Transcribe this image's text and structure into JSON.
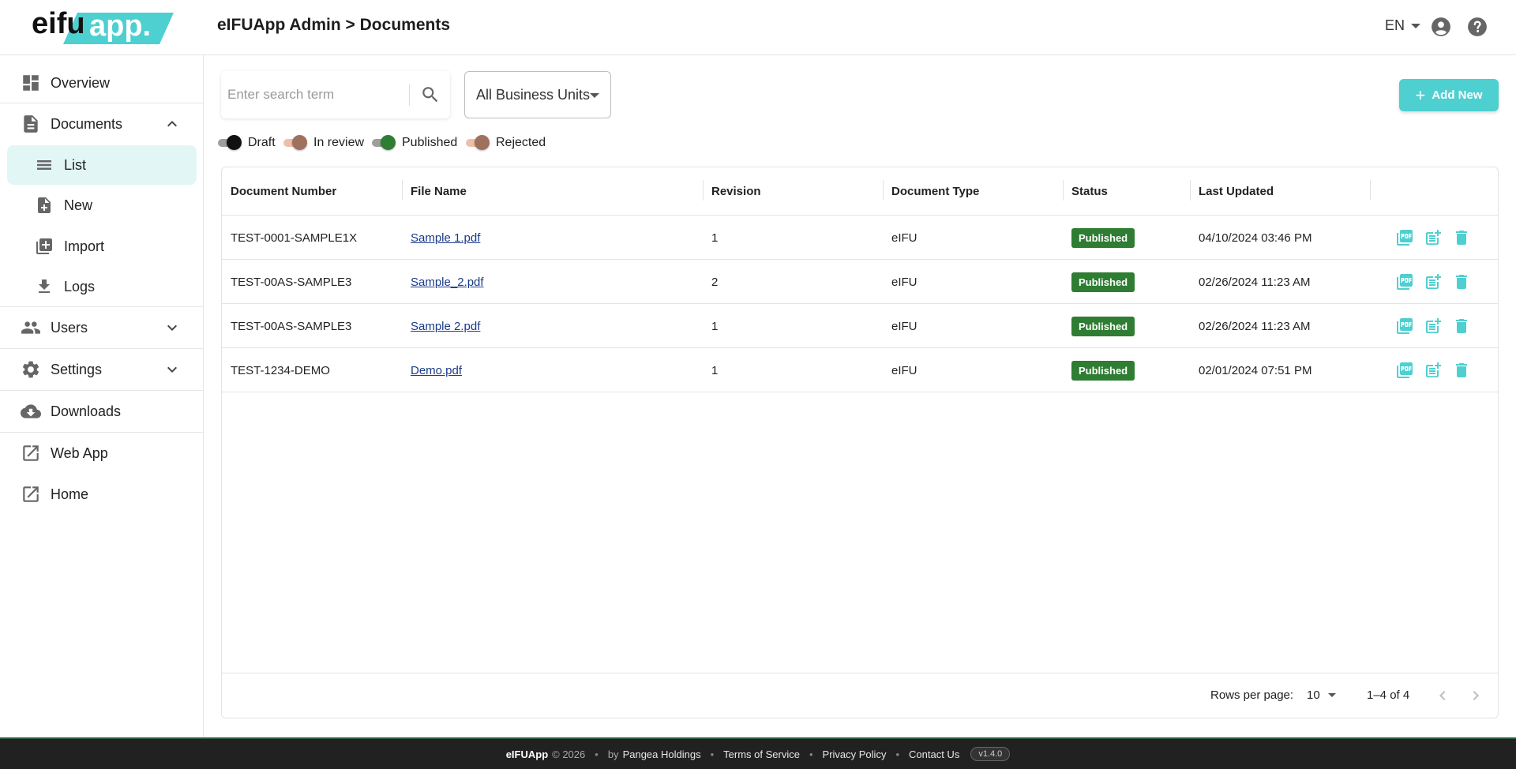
{
  "brand": {
    "logo_text_left": "eifu",
    "logo_text_right": "app.",
    "accent_color": "#4ecfd0"
  },
  "header": {
    "breadcrumb": "eIFUApp Admin > Documents",
    "language": "EN"
  },
  "sidebar": {
    "overview": "Overview",
    "documents": "Documents",
    "documents_sub": {
      "list": "List",
      "new": "New",
      "import": "Import",
      "logs": "Logs"
    },
    "users": "Users",
    "settings": "Settings",
    "downloads": "Downloads",
    "web_app": "Web App",
    "home": "Home"
  },
  "toolbar": {
    "search_placeholder": "Enter search term",
    "business_unit": "All Business Units",
    "add_new": "Add New"
  },
  "filters": [
    {
      "label": "Draft",
      "active": true,
      "color": "#111111"
    },
    {
      "label": "In review",
      "active": true,
      "color": "#a0705f"
    },
    {
      "label": "Published",
      "active": true,
      "color": "#2e7d32"
    },
    {
      "label": "Rejected",
      "active": true,
      "color": "#a0705f"
    }
  ],
  "table": {
    "columns": [
      "Document Number",
      "File Name",
      "Revision",
      "Document Type",
      "Status",
      "Last Updated"
    ],
    "rows": [
      {
        "number": "TEST-0001-SAMPLE1X",
        "file": "Sample 1.pdf",
        "revision": "1",
        "type": "eIFU",
        "status": "Published",
        "updated": "04/10/2024 03:46 PM"
      },
      {
        "number": "TEST-00AS-SAMPLE3",
        "file": "Sample_2.pdf",
        "revision": "2",
        "type": "eIFU",
        "status": "Published",
        "updated": "02/26/2024 11:23 AM"
      },
      {
        "number": "TEST-00AS-SAMPLE3",
        "file": "Sample 2.pdf",
        "revision": "1",
        "type": "eIFU",
        "status": "Published",
        "updated": "02/26/2024 11:23 AM"
      },
      {
        "number": "TEST-1234-DEMO",
        "file": "Demo.pdf",
        "revision": "1",
        "type": "eIFU",
        "status": "Published",
        "updated": "02/01/2024 07:51 PM"
      }
    ],
    "rows_per_page_label": "Rows per page:",
    "rows_per_page": "10",
    "range": "1–4 of 4"
  },
  "footer": {
    "app": "eIFUApp",
    "copyright": "© 2026",
    "by": "by",
    "company": "Pangea Holdings",
    "terms": "Terms of Service",
    "privacy": "Privacy Policy",
    "contact": "Contact Us",
    "version": "v1.4.0"
  }
}
